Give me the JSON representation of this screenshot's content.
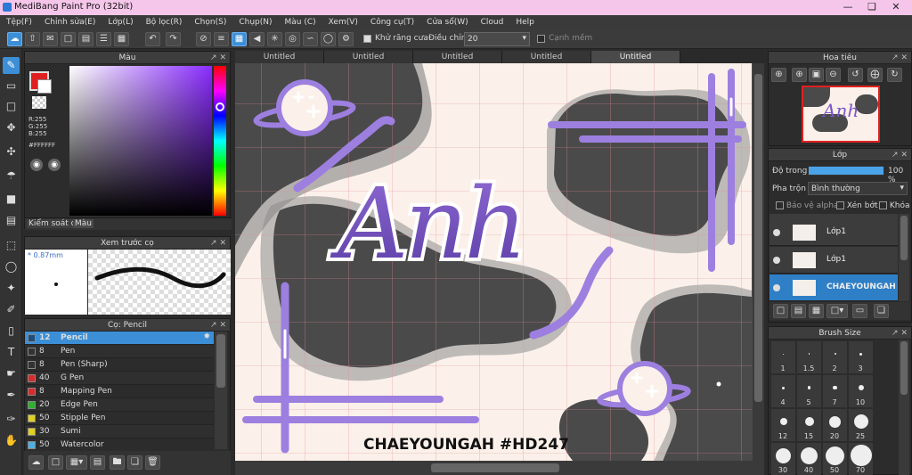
{
  "window": {
    "title": "MediBang Paint Pro (32bit)"
  },
  "menu": [
    "Tệp(F)",
    "Chỉnh sửa(E)",
    "Lớp(L)",
    "Bộ lọc(R)",
    "Chọn(S)",
    "Chụp(N)",
    "Màu (C)",
    "Xem(V)",
    "Công cụ(T)",
    "Cửa sổ(W)",
    "Cloud",
    "Help"
  ],
  "toolbar": {
    "antialias_label": "Khử răng cưa",
    "adjust_label": "Điều chỉnh",
    "adjust_value": "20",
    "smooth_edge_label": "Cạnh mềm"
  },
  "color_panel": {
    "title": "Màu",
    "r": "R:255",
    "g": "G:255",
    "b": "B:255",
    "hex": "#FFFFFF",
    "tabs": [
      "Kiểm soát cọ",
      "Màu"
    ],
    "primary_color": "#e02020",
    "hue_gradient": true
  },
  "brush_preview": {
    "title": "Xem trước cọ",
    "size": "0.87mm"
  },
  "brush_panel": {
    "title": "Cọ: Pencil",
    "brushes": [
      {
        "size": "12",
        "name": "Pencil",
        "color": "#1c4f80",
        "active": true
      },
      {
        "size": "8",
        "name": "Pen",
        "color": "#333333"
      },
      {
        "size": "8",
        "name": "Pen (Sharp)",
        "color": "#333333"
      },
      {
        "size": "40",
        "name": "G Pen",
        "color": "#d92b2b"
      },
      {
        "size": "8",
        "name": "Mapping Pen",
        "color": "#d92b2b"
      },
      {
        "size": "20",
        "name": "Edge Pen",
        "color": "#2fb02f"
      },
      {
        "size": "50",
        "name": "Stipple Pen",
        "color": "#e0d020"
      },
      {
        "size": "30",
        "name": "Sumi",
        "color": "#e0d020"
      },
      {
        "size": "50",
        "name": "Watercolor",
        "color": "#4fb0e0"
      }
    ]
  },
  "tabs": [
    "Untitled",
    "Untitled",
    "Untitled",
    "Untitled",
    "Untitled"
  ],
  "artwork": {
    "title_text": "Anh",
    "signature": "CHAEYOUNGAH #HD247"
  },
  "navigator": {
    "title": "Hoa tiêu"
  },
  "layers": {
    "title": "Lớp",
    "opacity_label": "Độ trong",
    "opacity_value": "100 %",
    "blend_label": "Pha trộn",
    "blend_value": "Bình thường",
    "protect_alpha": "Bảo vệ alpha",
    "clip": "Xén bớt",
    "lock": "Khóa",
    "items": [
      {
        "name": "Lớp1",
        "selected": false
      },
      {
        "name": "Lớp1",
        "selected": false
      },
      {
        "name": "CHAEYOUNGAH",
        "selected": true
      }
    ]
  },
  "brush_size": {
    "title": "Brush Size",
    "rows": [
      [
        "1",
        "1.5",
        "2",
        "3"
      ],
      [
        "4",
        "5",
        "7",
        "10"
      ],
      [
        "12",
        "15",
        "20",
        "25"
      ],
      [
        "30",
        "40",
        "50",
        "70"
      ]
    ]
  }
}
